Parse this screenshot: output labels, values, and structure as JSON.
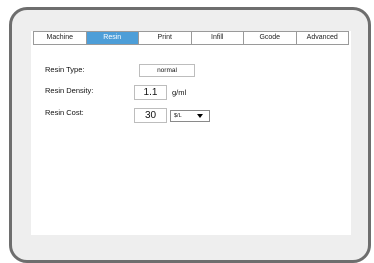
{
  "tabs": [
    {
      "label": "Machine"
    },
    {
      "label": "Resin"
    },
    {
      "label": "Print"
    },
    {
      "label": "Infill"
    },
    {
      "label": "Gcode"
    },
    {
      "label": "Advanced"
    }
  ],
  "active_tab": "Resin",
  "form": {
    "resin_type": {
      "label": "Resin Type:",
      "value": "normal"
    },
    "resin_density": {
      "label": "Resin Density:",
      "value": "1.1",
      "unit": "g/ml"
    },
    "resin_cost": {
      "label": "Resin Cost:",
      "value": "30",
      "currency": "$/L"
    }
  },
  "colors": {
    "active_tab": "#4d9ed8",
    "frame_border": "#6e6e6e",
    "frame_background": "#eeeeee"
  }
}
